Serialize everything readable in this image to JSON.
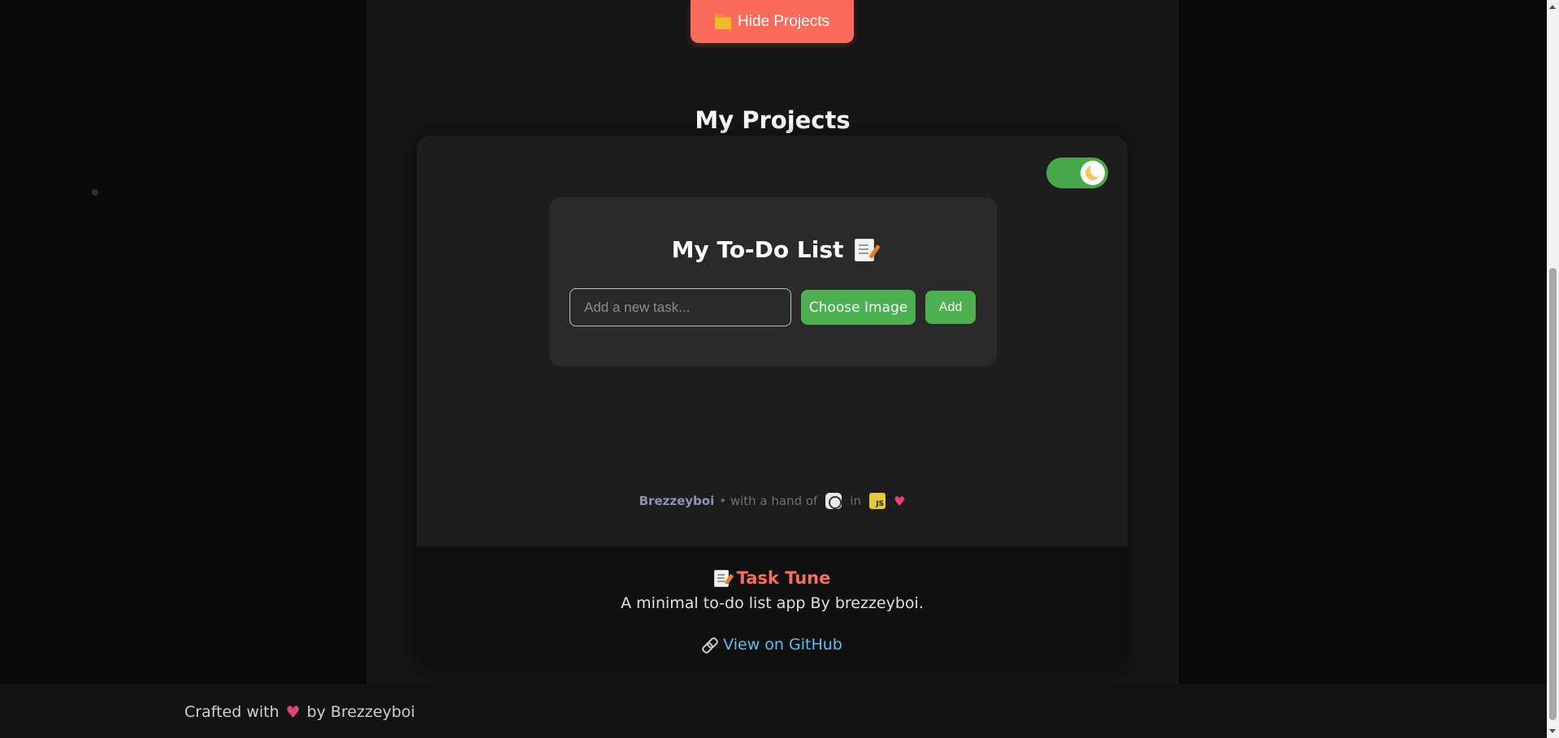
{
  "header": {
    "hide_projects_label": "Hide Projects",
    "folder_icon": "folder-icon"
  },
  "projects": {
    "title": "My Projects",
    "theme_toggle": {
      "state": "on",
      "icon": "moon-icon",
      "color": "#46a84a"
    }
  },
  "todo": {
    "title": "My To-Do List",
    "title_icon": "memo-icon",
    "input_placeholder": "Add a new task...",
    "input_value": "",
    "choose_image_label": "Choose Image",
    "add_label": "Add",
    "button_color": "#4caf50"
  },
  "credit": {
    "author": "Brezzeyboi",
    "text_with": "• with a hand of",
    "text_in": "in",
    "js_badge": "JS",
    "icons": [
      "openai-icon",
      "js-icon",
      "heart-icon"
    ]
  },
  "project_footer": {
    "title": "Task Tune",
    "title_icon": "memo-icon",
    "description": "A minimal to-do list app By brezzeyboi.",
    "github_label": "View on GitHub",
    "link_icon": "link-icon",
    "title_color": "#f2705f",
    "link_color": "#5bc0eb"
  },
  "page_footer": {
    "crafted_prefix": "Crafted with",
    "crafted_suffix": "by Brezzeyboi"
  },
  "colors": {
    "accent_red": "#fa6b5c",
    "background": "#0a0a0a"
  }
}
